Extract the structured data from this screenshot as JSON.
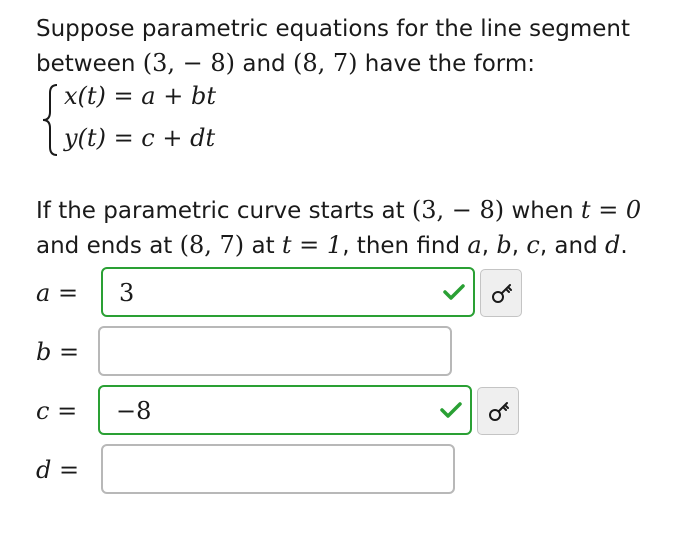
{
  "intro": {
    "line1": "Suppose parametric equations for the line segment",
    "line2_prefix": "between ",
    "point_a": "(3, − 8)",
    "and1": " and ",
    "point_b": "(8, 7)",
    "line2_suffix": " have the form:"
  },
  "system": {
    "eq1_lhs": "x(t)",
    "eq1_rhs": " = a + bt",
    "eq2_lhs": "y(t)",
    "eq2_rhs": " = c + dt"
  },
  "question": {
    "l1_prefix": "If the parametric curve starts at ",
    "l1_point": "(3, − 8)",
    "l1_when": " when ",
    "l1_cond": "t = 0",
    "l2_prefix": "and ends at ",
    "l2_point": "(8, 7)",
    "l2_at": " at ",
    "l2_cond": "t = 1",
    "l2_find": ", then find ",
    "v_a": "a",
    "comma1": ", ",
    "v_b": "b",
    "comma2": ", ",
    "v_c": "c",
    "and2": ", and ",
    "v_d": "d",
    "period": "."
  },
  "answers": [
    {
      "var": "a",
      "label_eq": " =",
      "value": "3",
      "status": "correct"
    },
    {
      "var": "b",
      "label_eq": " =",
      "value": "",
      "status": "blank"
    },
    {
      "var": "c",
      "label_eq": " =",
      "value": "−8",
      "status": "correct"
    },
    {
      "var": "d",
      "label_eq": " =",
      "value": "",
      "status": "blank"
    }
  ],
  "icons": {
    "correct": "checkmark-icon",
    "key": "key-icon"
  },
  "colors": {
    "correct_green": "#2aa034",
    "blank_border": "#b8b8b8",
    "key_button_bg": "#efefef"
  }
}
